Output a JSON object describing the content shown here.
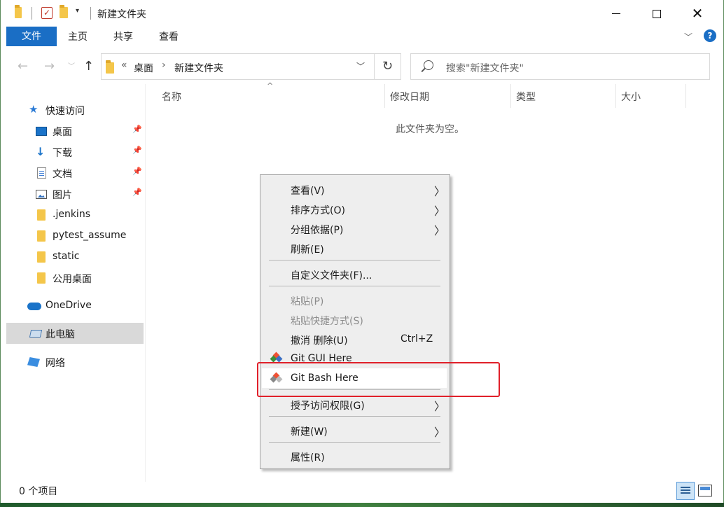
{
  "window": {
    "title": "新建文件夹",
    "controls": [
      "minimize",
      "maximize",
      "close"
    ]
  },
  "titlebar": {
    "icons": [
      "folder-icon",
      "properties-check-icon",
      "new-folder-icon",
      "customize-qat-dropdown-icon"
    ]
  },
  "ribbon": {
    "file_tab": "文件",
    "tabs": [
      "主页",
      "共享",
      "查看"
    ],
    "help": "?"
  },
  "address_bar": {
    "overflow": "«",
    "segments": [
      "桌面",
      "新建文件夹"
    ],
    "separator": "›"
  },
  "search": {
    "placeholder": "搜索\"新建文件夹\""
  },
  "sidebar": {
    "quick_access": "快速访问",
    "items": [
      {
        "label": "桌面",
        "icon": "desktop-icon",
        "pinned": true
      },
      {
        "label": "下载",
        "icon": "download-icon",
        "pinned": true
      },
      {
        "label": "文档",
        "icon": "document-icon",
        "pinned": true
      },
      {
        "label": "图片",
        "icon": "pictures-icon",
        "pinned": true
      },
      {
        "label": ".jenkins",
        "icon": "folder-icon",
        "pinned": false
      },
      {
        "label": "pytest_assume",
        "icon": "folder-icon",
        "pinned": false
      },
      {
        "label": "static",
        "icon": "folder-icon",
        "pinned": false
      },
      {
        "label": "公用桌面",
        "icon": "folder-icon",
        "pinned": false
      }
    ],
    "onedrive": "OneDrive",
    "this_pc": "此电脑",
    "network": "网络"
  },
  "content": {
    "columns": [
      "名称",
      "修改日期",
      "类型",
      "大小"
    ],
    "empty_message": "此文件夹为空。"
  },
  "status": {
    "item_count": "0 个项目"
  },
  "context_menu": {
    "items": [
      {
        "label": "查看(V)",
        "submenu": true
      },
      {
        "label": "排序方式(O)",
        "submenu": true
      },
      {
        "label": "分组依据(P)",
        "submenu": true
      },
      {
        "label": "刷新(E)"
      },
      {
        "label": "自定义文件夹(F)..."
      },
      {
        "label": "粘贴(P)",
        "disabled": true
      },
      {
        "label": "粘贴快捷方式(S)",
        "disabled": true
      },
      {
        "label": "撤消 删除(U)",
        "shortcut": "Ctrl+Z"
      },
      {
        "label": "Git GUI Here",
        "icon": "git-icon"
      },
      {
        "label": "Git Bash Here",
        "icon": "git-icon",
        "highlighted": true
      },
      {
        "label": "授予访问权限(G)",
        "submenu": true
      },
      {
        "label": "新建(W)",
        "submenu": true
      },
      {
        "label": "属性(R)"
      }
    ]
  },
  "colors": {
    "accent": "#1a6ec5",
    "highlight_box": "#e0202a",
    "menu_background": "#eeeeee",
    "git_icon": "#f05033"
  }
}
